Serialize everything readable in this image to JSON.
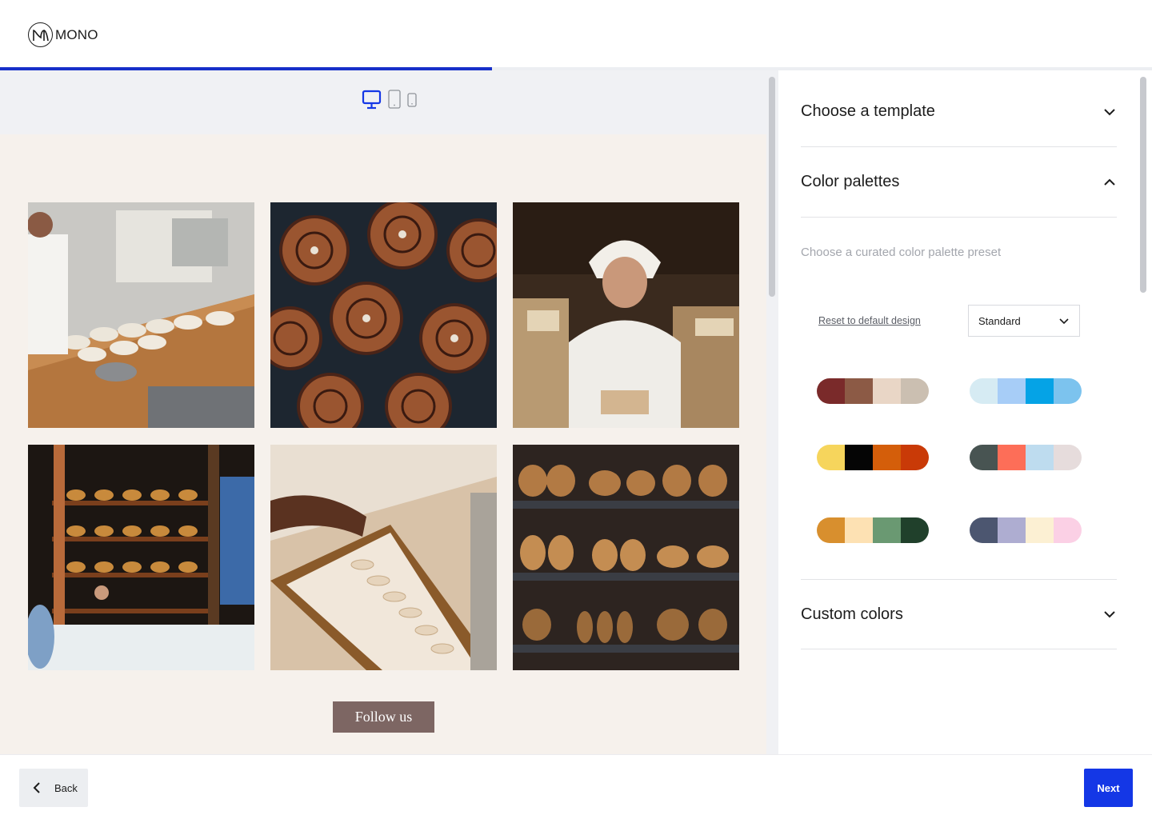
{
  "brand": {
    "mark": "M",
    "name": "MONO"
  },
  "progress": {
    "fraction": 0.427
  },
  "device_toggle": {
    "options": [
      "desktop-icon",
      "tablet-icon",
      "mobile-icon"
    ],
    "selected": "desktop-icon"
  },
  "preview": {
    "photos": [
      {
        "name": "photo-bakers-kneading-dough"
      },
      {
        "name": "photo-cinnamon-rolls"
      },
      {
        "name": "photo-baker-in-headscarf"
      },
      {
        "name": "photo-bakery-shelves"
      },
      {
        "name": "photo-shaping-pastries"
      },
      {
        "name": "photo-bread-shelves"
      }
    ],
    "follow_label": "Follow us"
  },
  "panel": {
    "template_section": {
      "title": "Choose a template",
      "expanded": false
    },
    "palettes_section": {
      "title": "Color palettes",
      "expanded": true,
      "subtitle": "Choose a curated color palette preset",
      "reset_label": "Reset to default design",
      "select_value": "Standard",
      "palettes": [
        [
          "#7a2a2a",
          "#8c5a45",
          "#e9d6c6",
          "#cbbfb1"
        ],
        [
          "#d6ebf3",
          "#a7cdf7",
          "#05a3e6",
          "#7cc3ee"
        ],
        [
          "#f6d55c",
          "#050505",
          "#d45e0a",
          "#c93a07"
        ],
        [
          "#485452",
          "#fd6e58",
          "#bedcef",
          "#e6dcdc"
        ],
        [
          "#d88f2e",
          "#fde1b3",
          "#6a9972",
          "#20402b"
        ],
        [
          "#4c5670",
          "#aeadd1",
          "#fcf0d3",
          "#fbd0e5"
        ]
      ]
    },
    "custom_section": {
      "title": "Custom colors",
      "expanded": false
    }
  },
  "footer": {
    "back_label": "Back",
    "next_label": "Next"
  },
  "colors": {
    "accent": "#1437e6",
    "progress": "#1730c9",
    "follow_button": "#7d6663",
    "preview_bg": "#f6f1ec"
  }
}
